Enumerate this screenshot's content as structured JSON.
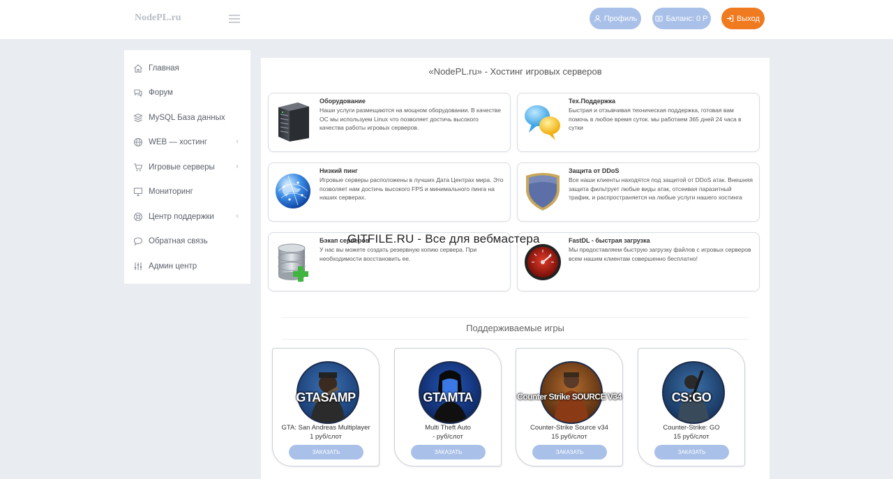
{
  "header": {
    "brand": "NodePL.ru",
    "profile_label": "Профиль",
    "balance_label": "Баланс: 0 Р",
    "exit_label": "Выход"
  },
  "sidebar": {
    "items": [
      {
        "label": "Главная",
        "icon": "home-icon"
      },
      {
        "label": "Форум",
        "icon": "chat-icon"
      },
      {
        "label": "MySQL База данных",
        "icon": "database-icon"
      },
      {
        "label": "WEB — хостинг",
        "icon": "globe-icon",
        "chevron": "‹"
      },
      {
        "label": "Игровые серверы",
        "icon": "cart-icon",
        "chevron": "‹"
      },
      {
        "label": "Мониторинг",
        "icon": "monitor-icon"
      },
      {
        "label": "Центр поддержки",
        "icon": "support-icon",
        "chevron": "‹"
      },
      {
        "label": "Обратная связь",
        "icon": "comment-icon"
      },
      {
        "label": "Админ центр",
        "icon": "sliders-icon"
      }
    ]
  },
  "main": {
    "title": "«NodePL.ru» - Хостинг игровых серверов",
    "features": [
      {
        "title": "Оборудование",
        "desc": "Наши услуги размещаются на мощном оборудовании. В качестве ОС мы используем Linux что позволяет достичь высокого качества работы игровых серверов.",
        "icon": "server-icon"
      },
      {
        "title": "Тех.Поддержка",
        "desc": "Быстрая и отзывчивая техническая поддержка, готовая вам помочь в любое время суток. мы работаем 365 дней 24 часа в сутки",
        "icon": "speech-bubbles-icon"
      },
      {
        "title": "Низкий пинг",
        "desc": "Игровые серверы расположены в лучших Дата Центрах мира. Это позволяет нам достичь высокого FPS и минимального пинга на наших серверах.",
        "icon": "globe-network-icon"
      },
      {
        "title": "Защита от DDoS",
        "desc": "Все наши клиенты находятся под защитой от DDoS атак. Внешняя защита фильтрует любые виды атак, отсеивая паразитный трафик, и распространяется на любые услуги нашего хостинга",
        "icon": "shield-icon"
      },
      {
        "title": "Бэкап серверов",
        "desc": "У нас вы можете создать резервную копию сервера. При необходимости восстановить ее.",
        "icon": "database-add-icon"
      },
      {
        "title": "FastDL - быстрая загрузка",
        "desc": "Мы предоставляем быструю загрузку файлов с игровых серверов всем нашим клиентам совершенно бесплатно!",
        "icon": "speedometer-icon"
      }
    ],
    "watermark": "GITFILE.RU - Все для вебмастера",
    "games_title": "Поддерживаемые игры",
    "games": [
      {
        "logo_text": "GTASAMP",
        "name": "GTA: San Andreas Multiplayer",
        "price": "1 руб/слот",
        "order_label": "ЗАКАЗАТЬ"
      },
      {
        "logo_text": "GTAMTA",
        "name": "Multi Theft Auto",
        "price": "- руб/слот",
        "order_label": "ЗАКАЗАТЬ"
      },
      {
        "logo_text": "Counter Strike SOURCE V34",
        "name": "Counter-Strike Source v34",
        "price": "15 руб/слот",
        "order_label": "ЗАКАЗАТЬ"
      },
      {
        "logo_text": "CS:GO",
        "name": "Counter-Strike: GO",
        "price": "15 руб/слот",
        "order_label": "ЗАКАЗАТЬ"
      }
    ]
  },
  "colors": {
    "accent": "#a9c0e8",
    "exit": "#f07a1f",
    "background": "#e9ecf1"
  }
}
